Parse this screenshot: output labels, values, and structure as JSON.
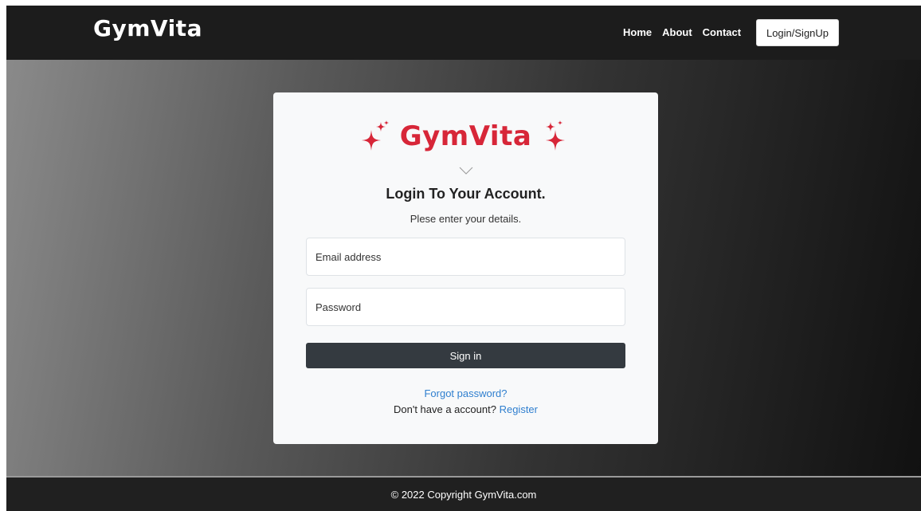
{
  "navbar": {
    "brand": "GymVita",
    "links": [
      "Home",
      "About",
      "Contact"
    ],
    "login_label": "Login/SignUp"
  },
  "card": {
    "logo_text": "GymVita",
    "logo_icon": "sparkle-icon",
    "title": "Login To Your Account.",
    "subtitle": "Plese enter your details.",
    "email_placeholder": "Email address",
    "password_placeholder": "Password",
    "signin_label": "Sign in",
    "forgot_label": "Forgot password?",
    "no_account_text": "Don't have a account?",
    "register_label": "Register"
  },
  "footer": {
    "text": "© 2022 Copyright GymVita.com"
  },
  "colors": {
    "brand_red": "#d72638",
    "nav_bg": "#1c1c1c",
    "button_dark": "#343a40",
    "link_blue": "#2f7fcf"
  }
}
